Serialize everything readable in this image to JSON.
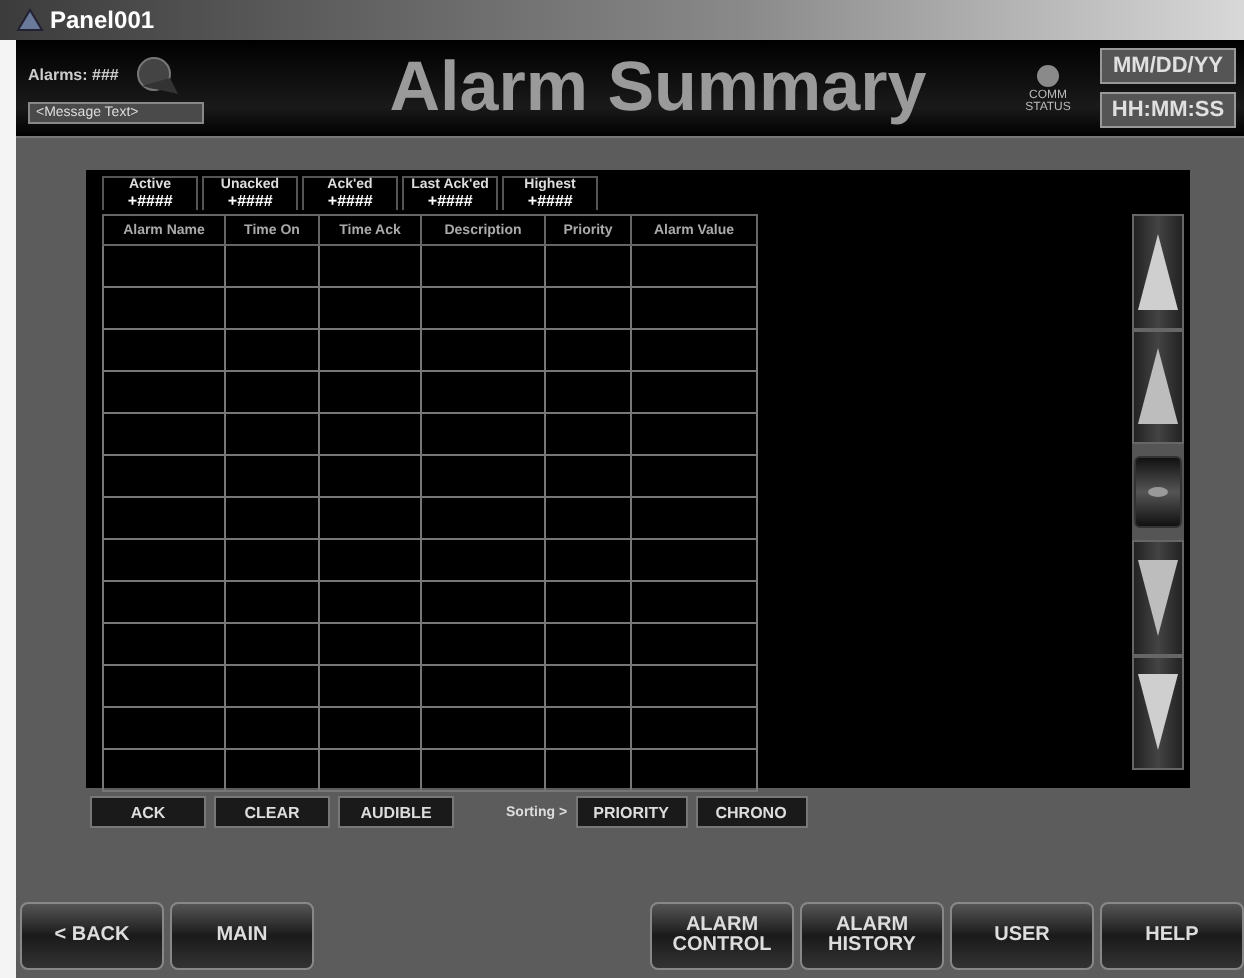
{
  "window": {
    "title": "Panel001"
  },
  "header": {
    "alarms": "Alarms: ###",
    "message": "<Message Text>",
    "title": "Alarm Summary",
    "comm_status": "COMM STATUS",
    "date": "MM/DD/YY",
    "time": "HH:MM:SS"
  },
  "counters": [
    {
      "label": "Active",
      "value": "+####"
    },
    {
      "label": "Unacked",
      "value": "+####"
    },
    {
      "label": "Ack'ed",
      "value": "+####"
    },
    {
      "label": "Last Ack'ed",
      "value": "+####"
    },
    {
      "label": "Highest",
      "value": "+####"
    }
  ],
  "table": {
    "columns": [
      "Alarm Name",
      "Time On",
      "Time Ack",
      "Description",
      "Priority",
      "Alarm Value"
    ]
  },
  "actions": [
    "ACK",
    "CLEAR",
    "AUDIBLE"
  ],
  "sorting": {
    "label": "Sorting >",
    "options": [
      "PRIORITY",
      "CHRONO"
    ]
  },
  "nav_left": [
    "< BACK",
    "MAIN"
  ],
  "nav_right": [
    "ALARM CONTROL",
    "ALARM HISTORY",
    "USER",
    "HELP"
  ]
}
